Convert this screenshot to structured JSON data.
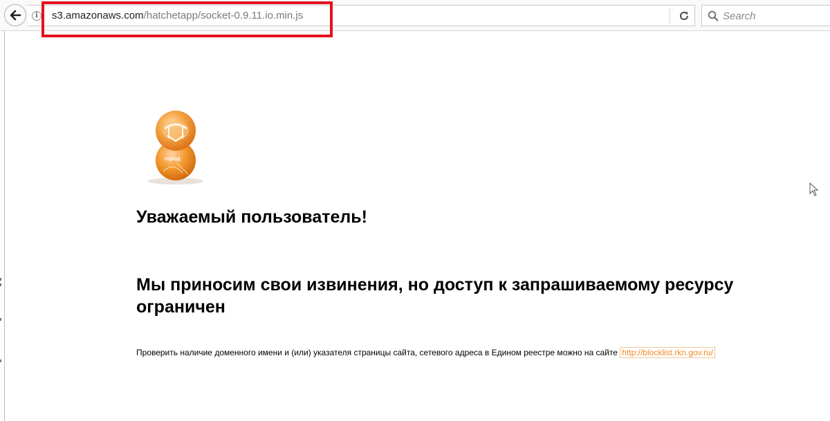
{
  "browser": {
    "url_domain": "s3.amazonaws.com",
    "url_path": "/hatchetapp/socket-0.9.11.io.min.js",
    "search_placeholder": "Search"
  },
  "page": {
    "greeting": "Уважаемый пользователь!",
    "apology": "Мы приносим свои извинения, но доступ к запрашиваемому ресурсу ограничен",
    "check_text": "Проверить наличие доменного имени и (или) указателя страницы сайта, сетевого адреса в Едином реестре можно на сайте",
    "check_link": "http://blocklist.rkn.gov.ru/",
    "logo_caption": "город"
  },
  "colors": {
    "highlight": "#e3111b",
    "logo_orange": "#f39a2e",
    "link": "#f08a24"
  },
  "icons": [
    "back-arrow-icon",
    "info-icon",
    "reload-icon",
    "search-icon",
    "mouse-cursor-icon"
  ]
}
